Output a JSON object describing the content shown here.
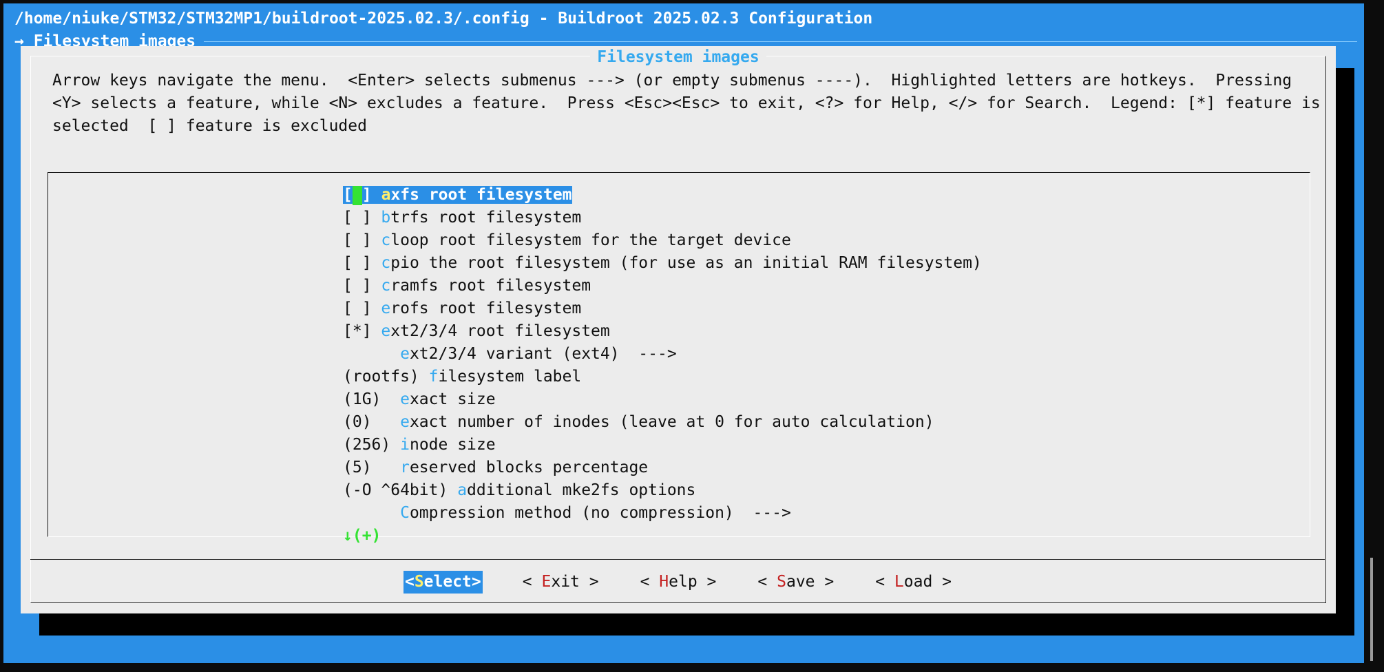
{
  "window": {
    "title": "/home/niuke/STM32/STM32MP1/buildroot-2025.02.3/.config - Buildroot 2025.02.3 Configuration",
    "breadcrumb": "→ Filesystem images"
  },
  "dialog": {
    "title": "Filesystem images",
    "help_text": "Arrow keys navigate the menu.  <Enter> selects submenus ---> (or empty submenus ----).  Highlighted letters are hotkeys.  Pressing <Y> selects a feature, while <N> excludes a feature.  Press <Esc><Esc> to exit, <?> for Help, </> for Search.  Legend: [*] feature is selected  [ ] feature is excluded"
  },
  "menu": {
    "items": [
      {
        "prefix": "[ ]",
        "gap": " ",
        "hotkey": "a",
        "rest": "xfs root filesystem",
        "selected": true
      },
      {
        "prefix": "[ ]",
        "gap": " ",
        "hotkey": "b",
        "rest": "trfs root filesystem"
      },
      {
        "prefix": "[ ]",
        "gap": " ",
        "hotkey": "c",
        "rest": "loop root filesystem for the target device"
      },
      {
        "prefix": "[ ]",
        "gap": " ",
        "hotkey": "c",
        "rest": "pio the root filesystem (for use as an initial RAM filesystem)"
      },
      {
        "prefix": "[ ]",
        "gap": " ",
        "hotkey": "c",
        "rest": "ramfs root filesystem"
      },
      {
        "prefix": "[ ]",
        "gap": " ",
        "hotkey": "e",
        "rest": "rofs root filesystem"
      },
      {
        "prefix": "[*]",
        "gap": " ",
        "hotkey": "e",
        "rest": "xt2/3/4 root filesystem"
      },
      {
        "prefix": "",
        "gap": "      ",
        "hotkey": "e",
        "rest": "xt2/3/4 variant (ext4)  --->"
      },
      {
        "prefix": "(rootfs)",
        "gap": " ",
        "hotkey": "f",
        "rest": "ilesystem label"
      },
      {
        "prefix": "(1G)",
        "gap": "  ",
        "hotkey": "e",
        "rest": "xact size"
      },
      {
        "prefix": "(0)",
        "gap": "   ",
        "hotkey": "e",
        "rest": "xact number of inodes (leave at 0 for auto calculation)"
      },
      {
        "prefix": "(256)",
        "gap": " ",
        "hotkey": "i",
        "rest": "node size"
      },
      {
        "prefix": "(5)",
        "gap": "   ",
        "hotkey": "r",
        "rest": "eserved blocks percentage"
      },
      {
        "prefix": "(-O ^64bit)",
        "gap": " ",
        "hotkey": "a",
        "rest": "dditional mke2fs options"
      },
      {
        "prefix": "",
        "gap": "      ",
        "hotkey": "C",
        "rest": "ompression method (no compression)  --->"
      }
    ],
    "more_indicator": "↓(+)"
  },
  "buttons": [
    {
      "open": "<",
      "key": "S",
      "rest": "elect",
      "close": ">",
      "active": true
    },
    {
      "open": "< ",
      "key": "E",
      "rest": "xit",
      "close": " >"
    },
    {
      "open": "< ",
      "key": "H",
      "rest": "elp",
      "close": " >"
    },
    {
      "open": "< ",
      "key": "S",
      "rest": "ave",
      "close": " >"
    },
    {
      "open": "< ",
      "key": "L",
      "rest": "oad",
      "close": " >"
    }
  ],
  "colors": {
    "background": "#2b8fe6",
    "dialog": "#ececec",
    "hotkey": "#35a9ef",
    "selected_hotkey": "#ffef6b",
    "button_key": "#c42020",
    "cursor": "#34e233"
  }
}
